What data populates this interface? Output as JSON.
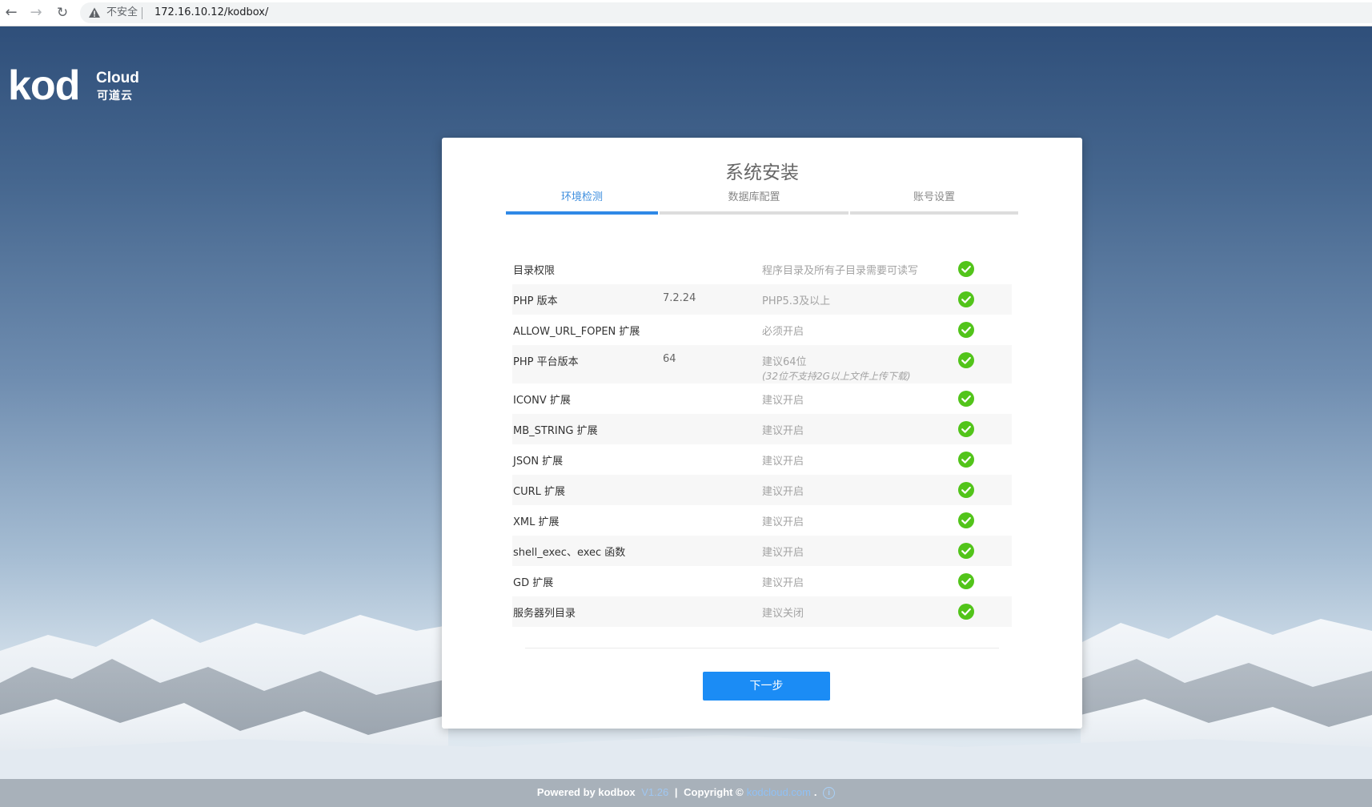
{
  "browser": {
    "security_label": "不安全",
    "url": "172.16.10.12/kodbox/"
  },
  "logo": {
    "main": "kod",
    "sub": "Cloud",
    "cn": "可道云"
  },
  "install": {
    "title": "系统安装",
    "steps": [
      {
        "label": "环境检测",
        "active": true
      },
      {
        "label": "数据库配置",
        "active": false
      },
      {
        "label": "账号设置",
        "active": false
      }
    ],
    "checks": [
      {
        "name": "目录权限",
        "value": "",
        "requirement": "程序目录及所有子目录需要可读写",
        "note": "",
        "status": "ok"
      },
      {
        "name": "PHP 版本",
        "value": "7.2.24",
        "requirement": "PHP5.3及以上",
        "note": "",
        "status": "ok"
      },
      {
        "name": "ALLOW_URL_FOPEN 扩展",
        "value": "",
        "requirement": "必须开启",
        "note": "",
        "status": "ok"
      },
      {
        "name": "PHP 平台版本",
        "value": "64",
        "requirement": "建议64位",
        "note": "(32位不支持2G以上文件上传下载)",
        "status": "ok"
      },
      {
        "name": "ICONV 扩展",
        "value": "",
        "requirement": "建议开启",
        "note": "",
        "status": "ok"
      },
      {
        "name": "MB_STRING 扩展",
        "value": "",
        "requirement": "建议开启",
        "note": "",
        "status": "ok"
      },
      {
        "name": "JSON 扩展",
        "value": "",
        "requirement": "建议开启",
        "note": "",
        "status": "ok"
      },
      {
        "name": "CURL 扩展",
        "value": "",
        "requirement": "建议开启",
        "note": "",
        "status": "ok"
      },
      {
        "name": "XML 扩展",
        "value": "",
        "requirement": "建议开启",
        "note": "",
        "status": "ok"
      },
      {
        "name": "shell_exec、exec 函数",
        "value": "",
        "requirement": "建议开启",
        "note": "",
        "status": "ok"
      },
      {
        "name": "GD 扩展",
        "value": "",
        "requirement": "建议开启",
        "note": "",
        "status": "ok"
      },
      {
        "name": "服务器列目录",
        "value": "",
        "requirement": "建议关闭",
        "note": "",
        "status": "ok"
      }
    ],
    "next_label": "下一步"
  },
  "footer": {
    "powered": "Powered by kodbox",
    "version": "V1.26",
    "separator": "|",
    "copyright": "Copyright ©",
    "site": "kodcloud.com",
    "dot": "."
  },
  "colors": {
    "accent": "#1b8cf5",
    "ok_green": "#52c41a",
    "sky_top": "#2f4f7a"
  }
}
